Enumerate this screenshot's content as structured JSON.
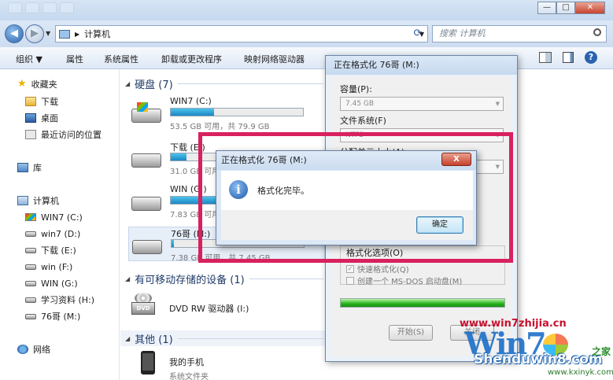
{
  "explorer": {
    "address": {
      "location": "计算机"
    },
    "search": {
      "placeholder": "搜索 计算机"
    },
    "commands": [
      "组织",
      "属性",
      "系统属性",
      "卸载或更改程序",
      "映射网络驱动器"
    ],
    "nav": {
      "favorites": "收藏夹",
      "fav_items": [
        "下载",
        "桌面",
        "最近访问的位置"
      ],
      "library": "库",
      "computer": "计算机",
      "drives": [
        "WIN7 (C:)",
        "win7 (D:)",
        "下载 (E:)",
        "win (F:)",
        "WIN (G:)",
        "学习资料 (H:)",
        "76哥 (M:)"
      ],
      "network": "网络"
    },
    "groups": {
      "hdd": "硬盘 (7)",
      "removable": "有可移动存储的设备 (1)",
      "other": "其他 (1)"
    },
    "drives": [
      {
        "name": "WIN7 (C:)",
        "size": "53.5 GB 可用，共 79.9 GB",
        "used_fraction": 0.33
      },
      {
        "name": "下载 (E:)",
        "size": "31.0 GB 可用，共 …",
        "used_fraction": 0.12
      },
      {
        "name": "WIN (G:)",
        "size": "7.83 GB 可用，共 …",
        "used_fraction": 0.85
      },
      {
        "name": "76哥 (M:)",
        "size": "7.38 GB 可用，共 7.45 GB",
        "used_fraction": 0.02
      }
    ],
    "dvd": {
      "name": "DVD RW 驱动器 (I:)",
      "icon_text": "DVD"
    },
    "device": {
      "name": "我的手机",
      "type": "系统文件夹"
    }
  },
  "format_dialog": {
    "title": "正在格式化 76哥 (M:)",
    "capacity_label": "容量(P):",
    "capacity_value": "7.45 GB",
    "fs_label": "文件系统(F)",
    "fs_value": "NTFS",
    "alloc_label": "分配单元大小(A)",
    "options_label": "格式化选项(O)",
    "quick_format": "快速格式化(Q)",
    "msdos_disk": "创建一个 MS-DOS 启动盘(M)",
    "progress_fraction": 1.0,
    "start_button": "开始(S)",
    "close_button": "关闭"
  },
  "message_box": {
    "title": "正在格式化 76哥 (M:)",
    "close_glyph": "X",
    "info_glyph": "i",
    "text": "格式化完毕。",
    "ok_button": "确定"
  },
  "watermark": {
    "line1": "www.win7zhijia.cn",
    "logo": "Win7",
    "line2": "Shenduwin8.com",
    "line3": "www.kxinyk.com",
    "green": "之家"
  }
}
